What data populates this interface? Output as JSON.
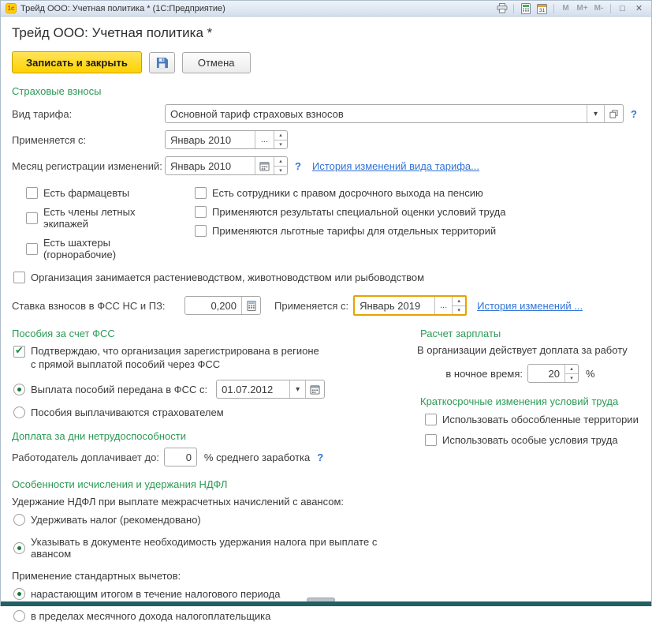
{
  "titlebar": {
    "logo": "1с",
    "title": "Трейд ООО: Учетная политика *  (1С:Предприятие)",
    "calendar_day": "31",
    "m": "M",
    "m_plus": "M+",
    "m_minus": "M-",
    "maximize_glyph": "□",
    "close_glyph": "✕"
  },
  "page": {
    "title": "Трейд ООО: Учетная политика *"
  },
  "toolbar": {
    "save_close": "Записать и закрыть",
    "cancel": "Отмена"
  },
  "insurance": {
    "title": "Страховые взносы",
    "tariff_label": "Вид тарифа:",
    "tariff_value": "Основной тариф страховых взносов",
    "tariff_help": "?",
    "applies_label": "Применяется с:",
    "applies_value": "Январь 2010",
    "more_button": "...",
    "reg_month_label": "Месяц регистрации изменений:",
    "reg_month_value": "Январь 2010",
    "reg_month_help": "?",
    "history_link": "История изменений вида тарифа...",
    "checks_col1": [
      "Есть фармацевты",
      "Есть члены летных экипажей",
      "Есть шахтеры (горнорабочие)"
    ],
    "checks_col2": [
      "Есть сотрудники с правом досрочного выхода на пенсию",
      "Применяются результаты специальной оценки условий труда",
      "Применяются льготные тарифы для отдельных территорий"
    ],
    "agro_check": "Организация занимается растениеводством, животноводством или рыбоводством",
    "rate_label": "Ставка взносов в ФСС НС и ПЗ:",
    "rate_value": "0,200",
    "rate_applies_label": "Применяется с:",
    "rate_applies_value": "Январь 2019",
    "rate_more_button": "...",
    "rate_history_link": "История изменений ..."
  },
  "benefits": {
    "title": "Пособия за счет ФСС",
    "confirm_line1": "Подтверждаю, что организация зарегистрирована в регионе",
    "confirm_line2": "с прямой выплатой пособий через ФСС",
    "paid_by_fss_label": "Выплата пособий передана в ФСС с:",
    "paid_by_fss_date": "01.07.2012",
    "paid_by_insurer_label": "Пособия выплачиваются страхователем"
  },
  "sick_pay": {
    "title": "Доплата за дни нетрудоспособности",
    "label": "Работодатель доплачивает до:",
    "value": "0",
    "suffix": "% среднего заработка",
    "help": "?"
  },
  "ndfl": {
    "title": "Особенности исчисления и удержания НДФЛ",
    "withhold_label": "Удержание НДФЛ при выплате межрасчетных начислений с авансом:",
    "option_withhold": "Удерживать налог (рекомендовано)",
    "option_document": "Указывать в документе необходимость удержания налога при выплате с авансом",
    "deduction_label": "Применение стандартных вычетов:",
    "option_cumulative": "нарастающим итогом в течение налогового периода",
    "option_monthly": "в пределах месячного дохода налогоплательщика"
  },
  "payroll": {
    "title": "Расчет зарплаты",
    "line1": "В организации действует доплата за работу",
    "night_label": "в ночное время:",
    "night_value": "20",
    "percent": "%"
  },
  "conditions": {
    "title": "Краткосрочные изменения условий труда",
    "check1": "Использовать обособленные территории",
    "check2": "Использовать особые условия труда"
  },
  "colors": {
    "accent_green": "#2b9a54",
    "link_blue": "#3173d6",
    "button_yellow": "#ffd200",
    "focus_orange": "#e8a200",
    "bottom_bar": "#235f63"
  }
}
